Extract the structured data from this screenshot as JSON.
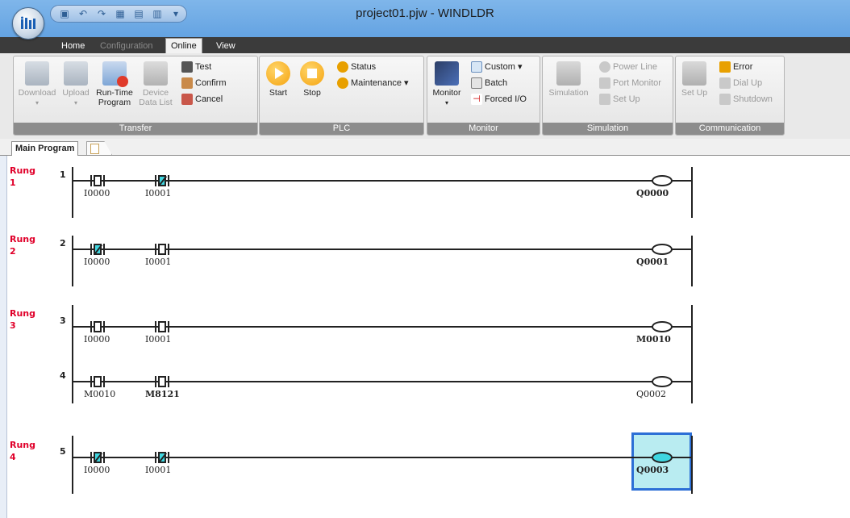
{
  "window": {
    "title": "project01.pjw - WINDLDR"
  },
  "ribbon_tabs": [
    {
      "label": "Home",
      "state": "normal"
    },
    {
      "label": "Configuration",
      "state": "disabled"
    },
    {
      "label": "Online",
      "state": "active"
    },
    {
      "label": "View",
      "state": "normal"
    }
  ],
  "groups": {
    "transfer": {
      "label": "Transfer",
      "download": "Download",
      "upload": "Upload",
      "runtime_l1": "Run-Time",
      "runtime_l2": "Program",
      "device_l1": "Device",
      "device_l2": "Data List",
      "test": "Test",
      "confirm": "Confirm",
      "cancel": "Cancel"
    },
    "plc": {
      "label": "PLC",
      "start": "Start",
      "stop": "Stop",
      "status": "Status",
      "maintenance": "Maintenance"
    },
    "monitor": {
      "label": "Monitor",
      "monitor": "Monitor",
      "custom": "Custom",
      "batch": "Batch",
      "forced": "Forced I/O"
    },
    "simulation": {
      "label": "Simulation",
      "simulation": "Simulation",
      "power_line": "Power Line",
      "port_monitor": "Port Monitor",
      "set_up": "Set Up"
    },
    "communication": {
      "label": "Communication",
      "set_up": "Set Up",
      "error": "Error",
      "dial_up": "Dial Up",
      "shutdown": "Shutdown"
    }
  },
  "doc_tabs": {
    "main": "Main Program"
  },
  "rung_word": "Rung",
  "rungs": [
    {
      "number": "1",
      "lines": [
        {
          "no": "1",
          "contacts": [
            {
              "op": "I0000",
              "type": "NO",
              "on": false,
              "bold": false
            },
            {
              "op": "I0001",
              "type": "NC",
              "on": true,
              "bold": false
            }
          ],
          "coil": {
            "op": "Q0000",
            "on": false,
            "bold": true
          }
        }
      ]
    },
    {
      "number": "2",
      "lines": [
        {
          "no": "2",
          "contacts": [
            {
              "op": "I0000",
              "type": "NC",
              "on": true,
              "bold": false
            },
            {
              "op": "I0001",
              "type": "NO",
              "on": false,
              "bold": false
            }
          ],
          "coil": {
            "op": "Q0001",
            "on": false,
            "bold": true
          }
        }
      ]
    },
    {
      "number": "3",
      "lines": [
        {
          "no": "3",
          "contacts": [
            {
              "op": "I0000",
              "type": "NO",
              "on": false,
              "bold": false
            },
            {
              "op": "I0001",
              "type": "NO",
              "on": false,
              "bold": false
            }
          ],
          "coil": {
            "op": "M0010",
            "on": false,
            "bold": true
          }
        },
        {
          "no": "4",
          "contacts": [
            {
              "op": "M0010",
              "type": "NO",
              "on": false,
              "bold": false
            },
            {
              "op": "M8121",
              "type": "NO",
              "on": false,
              "bold": true
            }
          ],
          "coil": {
            "op": "Q0002",
            "on": false,
            "bold": false
          }
        }
      ]
    },
    {
      "number": "4",
      "lines": [
        {
          "no": "5",
          "contacts": [
            {
              "op": "I0000",
              "type": "NC",
              "on": true,
              "bold": false
            },
            {
              "op": "I0001",
              "type": "NC",
              "on": true,
              "bold": false
            }
          ],
          "coil": {
            "op": "Q0003",
            "on": true,
            "bold": true,
            "selected": true
          }
        }
      ]
    }
  ],
  "colors": {
    "rung_label": "#e0002a",
    "energized": "#3fd6e0",
    "selection": "#2c6fd6"
  }
}
